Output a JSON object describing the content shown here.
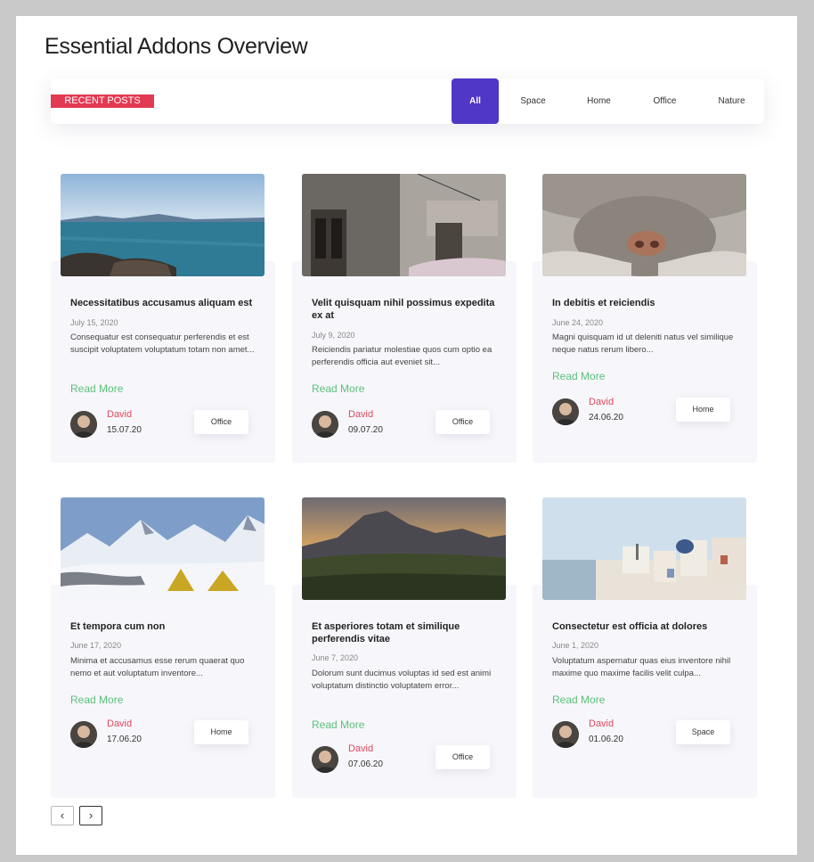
{
  "page": {
    "title": "Essential Addons Overview"
  },
  "filter": {
    "badge": "RECENT POSTS",
    "tabs": [
      "All",
      "Space",
      "Home",
      "Office",
      "Nature"
    ],
    "active_tab": "All"
  },
  "posts": [
    {
      "title": "Necessitatibus accusamus aliquam est",
      "date": "July 15, 2020",
      "excerpt": "Consequatur est consequatur perferendis et est suscipit voluptatem voluptatum totam non amet...",
      "read_more": "Read More",
      "author": "David",
      "post_date": "15.07.20",
      "category": "Office",
      "image": "sea-coast-image"
    },
    {
      "title": "Velit quisquam nihil possimus expedita ex at",
      "date": "July 9, 2020",
      "excerpt": "Reiciendis pariatur molestiae quos cum optio ea perferendis officia aut eveniet sit...",
      "read_more": "Read More",
      "author": "David",
      "post_date": "09.07.20",
      "category": "Office",
      "image": "old-building-image"
    },
    {
      "title": "In debitis et reiciendis",
      "date": "June 24, 2020",
      "excerpt": "Magni quisquam id ut deleniti natus vel similique neque natus rerum libero...",
      "read_more": "Read More",
      "author": "David",
      "post_date": "24.06.20",
      "category": "Home",
      "image": "cat-nose-image"
    },
    {
      "title": "Et tempora cum non",
      "date": "June 17, 2020",
      "excerpt": "Minima et accusamus esse rerum quaerat quo nemo et aut voluptatum inventore...",
      "read_more": "Read More",
      "author": "David",
      "post_date": "17.06.20",
      "category": "Home",
      "image": "snowy-camp-image"
    },
    {
      "title": "Et asperiores totam et similique perferendis vitae",
      "date": "June 7, 2020",
      "excerpt": "Dolorum sunt ducimus voluptas id sed est animi voluptatum distinctio voluptatem error...",
      "read_more": "Read More",
      "author": "David",
      "post_date": "07.06.20",
      "category": "Office",
      "image": "mountain-sunset-image"
    },
    {
      "title": "Consectetur est officia at dolores",
      "date": "June 1, 2020",
      "excerpt": "Voluptatum aspernatur quas eius inventore nihil maxime quo maxime facilis velit culpa...",
      "read_more": "Read More",
      "author": "David",
      "post_date": "01.06.20",
      "category": "Space",
      "image": "santorini-village-image"
    }
  ],
  "pagination": {
    "prev": "‹",
    "next": "›"
  },
  "colors": {
    "accent": "#5137c5",
    "badge": "#e23a52",
    "read_more": "#5bbf7a",
    "author": "#e4475c"
  }
}
